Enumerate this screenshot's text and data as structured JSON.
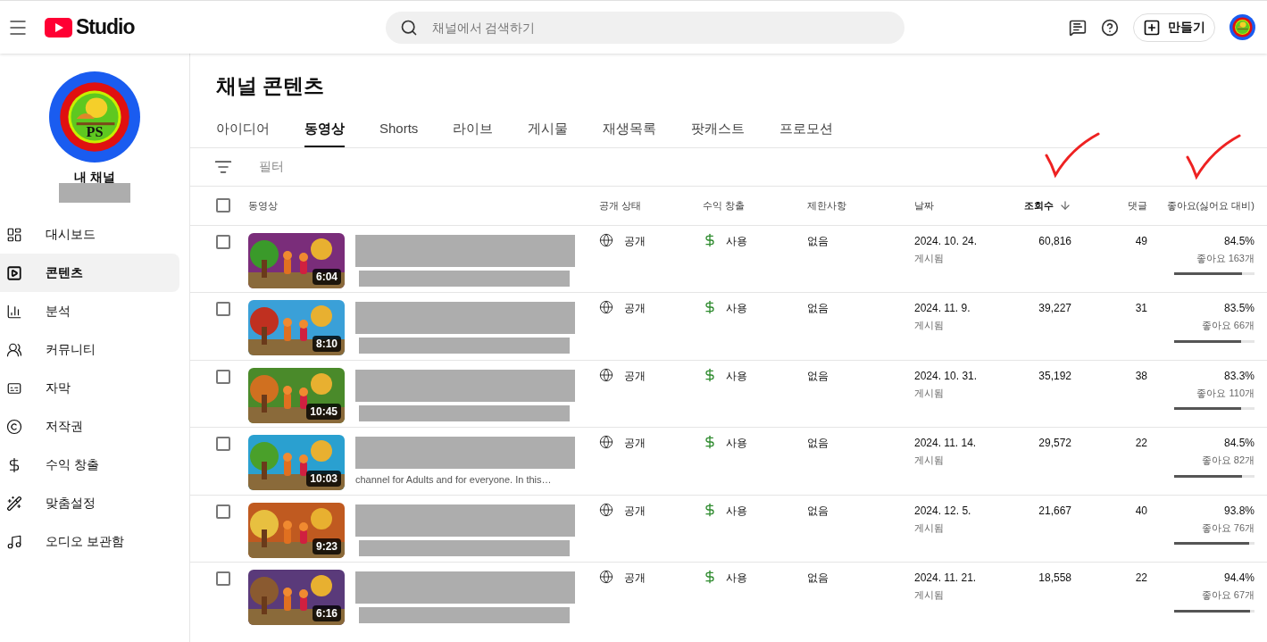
{
  "header": {
    "logo_text": "Studio",
    "search": {
      "placeholder": "채널에서 검색하기"
    },
    "create_label": "만들기"
  },
  "channel": {
    "avatar_text": "PS",
    "name": "내 채널"
  },
  "sidebar": {
    "items": [
      {
        "label": "대시보드",
        "selected": false
      },
      {
        "label": "콘텐츠",
        "selected": true
      },
      {
        "label": "분석",
        "selected": false
      },
      {
        "label": "커뮤니티",
        "selected": false
      },
      {
        "label": "자막",
        "selected": false
      },
      {
        "label": "저작권",
        "selected": false
      },
      {
        "label": "수익 창출",
        "selected": false
      },
      {
        "label": "맞춤설정",
        "selected": false
      },
      {
        "label": "오디오 보관함",
        "selected": false
      }
    ]
  },
  "page_title": "채널 콘텐츠",
  "tabs": [
    {
      "label": "아이디어",
      "selected": false
    },
    {
      "label": "동영상",
      "selected": true
    },
    {
      "label": "Shorts",
      "selected": false
    },
    {
      "label": "라이브",
      "selected": false
    },
    {
      "label": "게시물",
      "selected": false
    },
    {
      "label": "재생목록",
      "selected": false
    },
    {
      "label": "팟캐스트",
      "selected": false
    },
    {
      "label": "프로모션",
      "selected": false
    }
  ],
  "filter_label": "필터",
  "table": {
    "select_all_checked": false,
    "columns": [
      {
        "label": "동영상",
        "sorted": false
      },
      {
        "label": "공개 상태",
        "sorted": false
      },
      {
        "label": "수익 창출",
        "sorted": false
      },
      {
        "label": "제한사항",
        "sorted": false
      },
      {
        "label": "날짜",
        "sorted": false
      },
      {
        "label": "조회수",
        "sorted": true
      },
      {
        "label": "댓글",
        "sorted": false
      },
      {
        "label": "좋아요(싫어요 대비)",
        "sorted": false
      }
    ],
    "rows": [
      {
        "checked": false,
        "duration": "6:04",
        "visibility": "공개",
        "monetization": "사용",
        "restrictions": "없음",
        "date": "2024. 10. 24.",
        "date_status": "게시됨",
        "views": "60,816",
        "comments": "49",
        "like_ratio": "84.5%",
        "likes": "좋아요 163개",
        "level": 0.845
      },
      {
        "checked": false,
        "duration": "8:10",
        "visibility": "공개",
        "monetization": "사용",
        "restrictions": "없음",
        "date": "2024. 11. 9.",
        "date_status": "게시됨",
        "views": "39,227",
        "comments": "31",
        "like_ratio": "83.5%",
        "likes": "좋아요 66개",
        "level": 0.835
      },
      {
        "checked": false,
        "duration": "10:45",
        "visibility": "공개",
        "monetization": "사용",
        "restrictions": "없음",
        "date": "2024. 10. 31.",
        "date_status": "게시됨",
        "views": "35,192",
        "comments": "38",
        "like_ratio": "83.3%",
        "likes": "좋아요 110개",
        "level": 0.833
      },
      {
        "checked": false,
        "duration": "10:03",
        "description": "channel for Adults and for everyone. In this…",
        "visibility": "공개",
        "monetization": "사용",
        "restrictions": "없음",
        "date": "2024. 11. 14.",
        "date_status": "게시됨",
        "views": "29,572",
        "comments": "22",
        "like_ratio": "84.5%",
        "likes": "좋아요 82개",
        "level": 0.845
      },
      {
        "checked": false,
        "duration": "9:23",
        "visibility": "공개",
        "monetization": "사용",
        "restrictions": "없음",
        "date": "2024. 12. 5.",
        "date_status": "게시됨",
        "views": "21,667",
        "comments": "40",
        "like_ratio": "93.8%",
        "likes": "좋아요 76개",
        "level": 0.938
      },
      {
        "checked": false,
        "duration": "6:16",
        "visibility": "공개",
        "monetization": "사용",
        "restrictions": "없음",
        "date": "2024. 11. 21.",
        "date_status": "게시됨",
        "views": "18,558",
        "comments": "22",
        "like_ratio": "94.4%",
        "likes": "좋아요 67개",
        "level": 0.944
      }
    ]
  }
}
